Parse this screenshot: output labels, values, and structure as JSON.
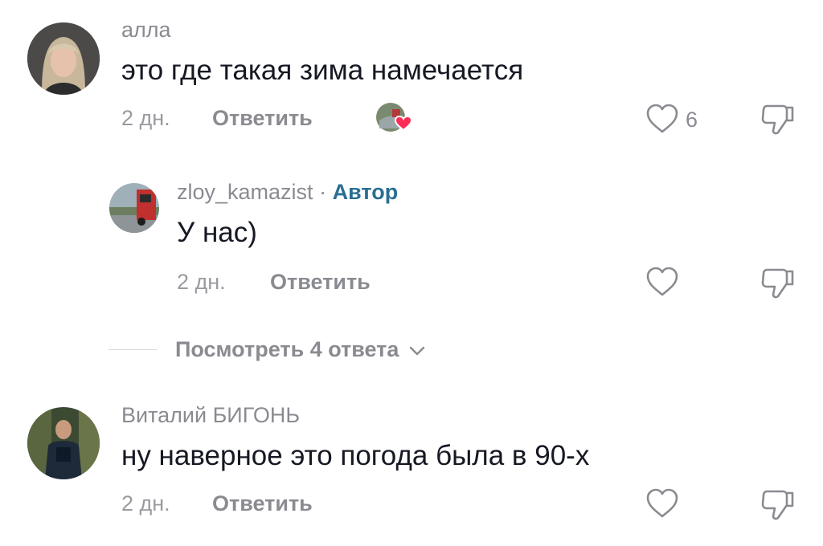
{
  "comments": [
    {
      "author": "алла",
      "text": "это где такая зима намечается",
      "date": "2 дн.",
      "reply_label": "Ответить",
      "likes": "6"
    },
    {
      "author": "zloy_kamazist",
      "separator": "·",
      "author_badge": "Автор",
      "text": "У нас)",
      "date": "2 дн.",
      "reply_label": "Ответить"
    },
    {
      "author": "Виталий БИГОНЬ",
      "text": "ну наверное это погода была в 90-х",
      "date": "2 дн.",
      "reply_label": "Ответить"
    }
  ],
  "view_replies_label": "Посмотреть 4 ответа",
  "icons": {
    "like": "heart-outline-icon",
    "dislike": "thumbs-down-outline-icon",
    "creator_liked": "creator-liked-heart-icon",
    "expand": "chevron-down-icon"
  },
  "colors": {
    "text_primary": "#161823",
    "text_secondary": "#8a8b91",
    "author_badge": "#2a6f93",
    "liked_heart": "#fe2c55"
  }
}
